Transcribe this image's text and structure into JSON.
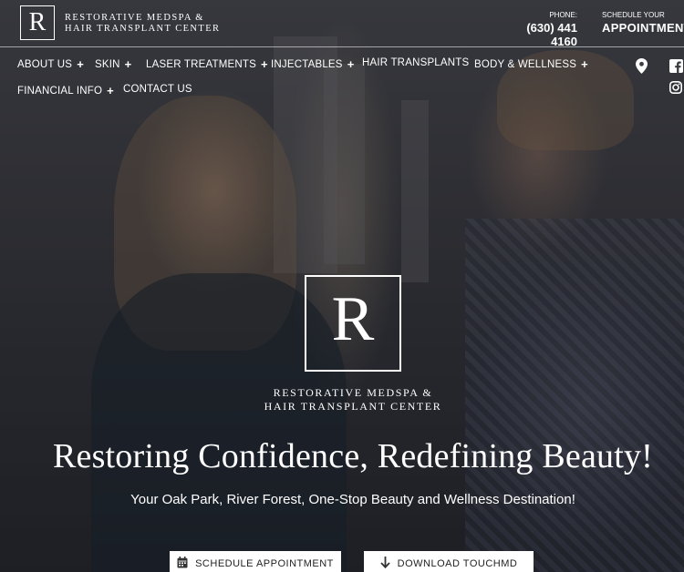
{
  "header": {
    "logo_letter": "R",
    "logo_line1": "RESTORATIVE MEDSPA &",
    "logo_line2": "HAIR TRANSPLANT CENTER",
    "phone_label": "PHONE:",
    "phone_number": "(630) 441 4160",
    "appointment_label": "SCHEDULE YOUR",
    "appointment_value": "APPOINTMENT"
  },
  "nav": {
    "items": [
      {
        "label": "ABOUT US",
        "has_submenu": true
      },
      {
        "label": "SKIN",
        "has_submenu": true
      },
      {
        "label": "LASER TREATMENTS",
        "has_submenu": true
      },
      {
        "label": "INJECTABLES",
        "has_submenu": true
      },
      {
        "label": "HAIR TRANSPLANTS",
        "has_submenu": false
      },
      {
        "label": "BODY & WELLNESS",
        "has_submenu": true
      },
      {
        "label": "FINANCIAL INFO",
        "has_submenu": true
      },
      {
        "label": "CONTACT US",
        "has_submenu": false
      }
    ],
    "plus_symbol": "+"
  },
  "social": {
    "icons": [
      "map-pin-icon",
      "facebook-icon",
      "instagram-icon"
    ]
  },
  "hero": {
    "logo_letter": "R",
    "name_line1": "RESTORATIVE MEDSPA &",
    "name_line2": "HAIR TRANSPLANT CENTER",
    "headline": "Restoring Confidence, Redefining Beauty!",
    "subheadline": "Your Oak Park, River Forest, One-Stop Beauty and Wellness Destination!",
    "buttons": [
      {
        "label": "SCHEDULE APPOINTMENT",
        "icon": "calendar-icon"
      },
      {
        "label": "DOWNLOAD TOUCHMD",
        "icon": "arrow-down-icon"
      }
    ]
  }
}
